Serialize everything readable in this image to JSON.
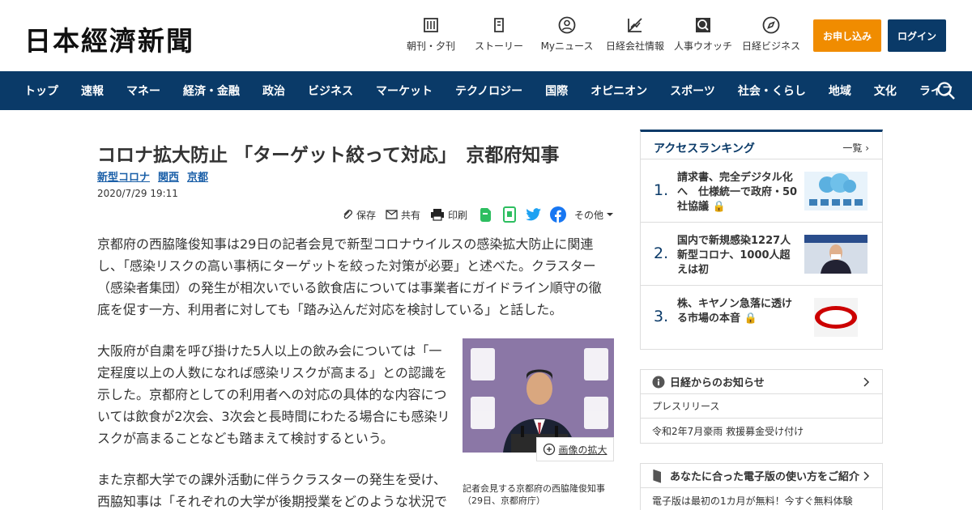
{
  "header": {
    "logo": "日本經濟新聞",
    "tools": [
      {
        "label": "朝刊・夕刊",
        "icon": "newspaper-icon"
      },
      {
        "label": "ストーリー",
        "icon": "story-icon"
      },
      {
        "label": "Myニュース",
        "icon": "user-icon"
      },
      {
        "label": "日経会社情報",
        "icon": "chart-icon"
      },
      {
        "label": "人事ウオッチ",
        "icon": "person-search-icon"
      },
      {
        "label": "日経ビジネス",
        "icon": "compass-icon"
      }
    ],
    "apply_label": "お申し込み",
    "login_label": "ログイン",
    "colors": {
      "apply": "#f08c00",
      "navy": "#0a3a68"
    }
  },
  "nav": {
    "items": [
      "トップ",
      "速報",
      "マネー",
      "経済・金融",
      "政治",
      "ビジネス",
      "マーケット",
      "テクノロジー",
      "国際",
      "オピニオン",
      "スポーツ",
      "社会・くらし",
      "地域",
      "文化",
      "ライフ"
    ]
  },
  "article": {
    "headline": "コロナ拡大防止 「ターゲット絞って対応」　京都府知事",
    "tags": [
      "新型コロナ",
      "関西",
      "京都"
    ],
    "date": "2020/7/29 19:11",
    "share": {
      "save": "保存",
      "share": "共有",
      "print": "印刷",
      "more": "その他"
    },
    "paragraphs": [
      "京都府の西脇隆俊知事は29日の記者会見で新型コロナウイルスの感染拡大防止に関連し、「感染リスクの高い事柄にターゲットを絞った対策が必要」と述べた。クラスター（感染者集団）の発生が相次いでいる飲食店については事業者にガイドライン順守の徹底を促す一方、利用者に対しても「踏み込んだ対応を検討している」と話した。",
      "大阪府が自粛を呼び掛けた5人以上の飲み会については「一定程度以上の人数になれば感染リスクが高まる」との認識を示した。京都府としての利用者への対応の具体的な内容については飲食が2次会、3次会と長時間にわたる場合にも感染リスクが高まることなども踏まえて検討するという。",
      "また京都大学での課外活動に伴うクラスターの発生を受け、西脇知事は「それぞれの大学が後期授業をどのような状況で"
    ],
    "figure": {
      "zoom_label": "画像の拡大",
      "caption": "記者会見する京都府の西脇隆俊知事（29日、京都府庁）"
    }
  },
  "ranking": {
    "title": "アクセスランキング",
    "all_label": "一覧",
    "items": [
      {
        "num": "1.",
        "text": "請求書、完全デジタル化へ　仕様統一で政府・50社協議"
      },
      {
        "num": "2.",
        "text": "国内で新規感染1227人　新型コロナ、1000人超えは初"
      },
      {
        "num": "3.",
        "text": "株、キヤノン急落に透ける市場の本音"
      }
    ]
  },
  "info": {
    "title": "日経からのお知らせ",
    "rows": [
      "プレスリリース",
      "令和2年7月豪雨 救援募金受け付け"
    ]
  },
  "guide": {
    "title": "あなたに合った電子版の使い方をご紹介",
    "rows": [
      "電子版は最初の1カ月が無料！今すぐ無料体験"
    ]
  }
}
